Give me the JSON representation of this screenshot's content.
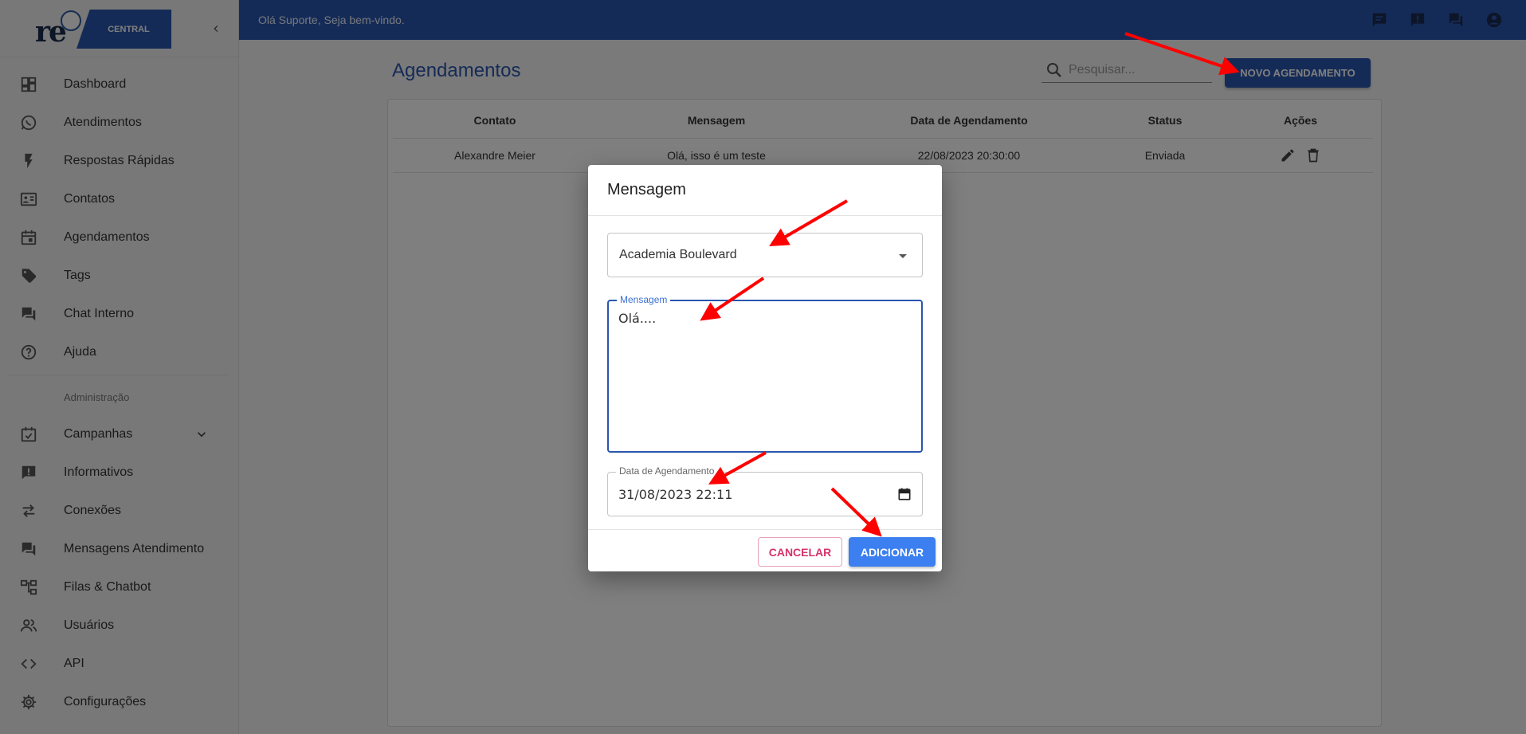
{
  "brand": {
    "logo_text": "re",
    "logo_badge": "CENTRAL"
  },
  "sidebar": {
    "items": [
      {
        "label": "Dashboard",
        "icon": "dashboard-icon"
      },
      {
        "label": "Atendimentos",
        "icon": "whatsapp-icon"
      },
      {
        "label": "Respostas Rápidas",
        "icon": "flash-icon"
      },
      {
        "label": "Contatos",
        "icon": "contact-card-icon"
      },
      {
        "label": "Agendamentos",
        "icon": "calendar-icon"
      },
      {
        "label": "Tags",
        "icon": "tag-icon"
      },
      {
        "label": "Chat Interno",
        "icon": "forum-icon"
      },
      {
        "label": "Ajuda",
        "icon": "help-icon"
      }
    ],
    "section_label": "Administração",
    "admin_items": [
      {
        "label": "Campanhas",
        "icon": "event-available-icon"
      },
      {
        "label": "Informativos",
        "icon": "announcement-icon"
      },
      {
        "label": "Conexões",
        "icon": "sync-alt-icon"
      },
      {
        "label": "Mensagens Atendimento",
        "icon": "chat-bubble-icon"
      },
      {
        "label": "Filas & Chatbot",
        "icon": "account-tree-icon"
      },
      {
        "label": "Usuários",
        "icon": "people-icon"
      },
      {
        "label": "API",
        "icon": "code-icon"
      },
      {
        "label": "Configurações",
        "icon": "settings-icon"
      }
    ]
  },
  "topbar": {
    "welcome": "Olá Suporte, Seja bem-vindo."
  },
  "page": {
    "title": "Agendamentos",
    "search_placeholder": "Pesquisar...",
    "new_button": "NOVO AGENDAMENTO"
  },
  "table": {
    "headers": [
      "Contato",
      "Mensagem",
      "Data de Agendamento",
      "Status",
      "Ações"
    ],
    "rows": [
      {
        "contato": "Alexandre Meier",
        "mensagem": "Olá, isso é um teste",
        "data": "22/08/2023 20:30:00",
        "status": "Enviada"
      }
    ]
  },
  "dialog": {
    "title": "Mensagem",
    "contact_value": "Academia Boulevard",
    "message_label": "Mensagem",
    "message_value": "Olá....",
    "date_label": "Data de Agendamento",
    "date_value": "31/08/2023 22:11",
    "cancel_label": "CANCELAR",
    "add_label": "ADICIONAR"
  },
  "colors": {
    "primary": "#2a56ae",
    "add_button": "#3b7ff0",
    "cancel": "#d6336c",
    "arrow": "#ff0000"
  }
}
